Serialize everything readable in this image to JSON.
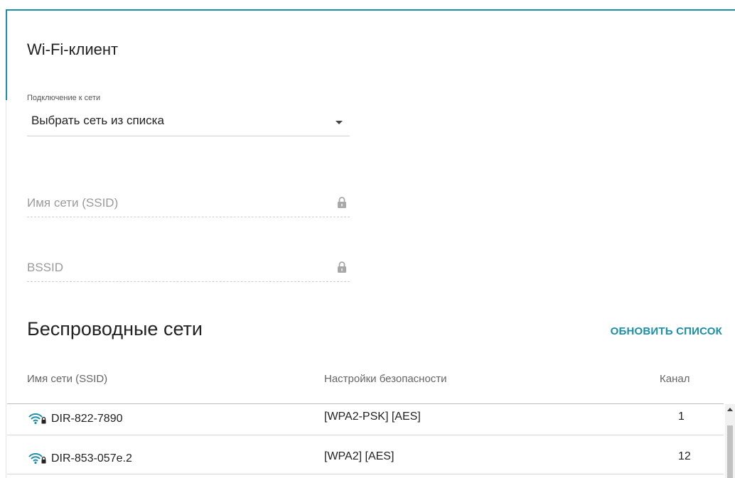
{
  "client_section": {
    "title": "Wi-Fi-клиент"
  },
  "connection": {
    "label": "Подключение к сети",
    "value": "Выбрать сеть из списка"
  },
  "ssid_field": {
    "placeholder": "Имя сети (SSID)"
  },
  "bssid_field": {
    "placeholder": "BSSID"
  },
  "wireless": {
    "title": "Беспроводные сети",
    "refresh_label": "ОБНОВИТЬ СПИСОК",
    "columns": [
      "Имя сети (SSID)",
      "Настройки безопасности",
      "Канал"
    ],
    "rows": [
      {
        "ssid": "DIR-822-7890",
        "security": "[WPA2-PSK] [AES]",
        "channel": "1"
      },
      {
        "ssid": "DIR-853-057e.2",
        "security": "[WPA2] [AES]",
        "channel": "12"
      }
    ]
  },
  "colors": {
    "accent": "#1b8fa8",
    "wifi_icon": "#1b8fa8"
  },
  "icons": {
    "lock": "lock-icon",
    "wifi": "wifi-secured-icon",
    "dropdown": "chevron-down-icon"
  }
}
